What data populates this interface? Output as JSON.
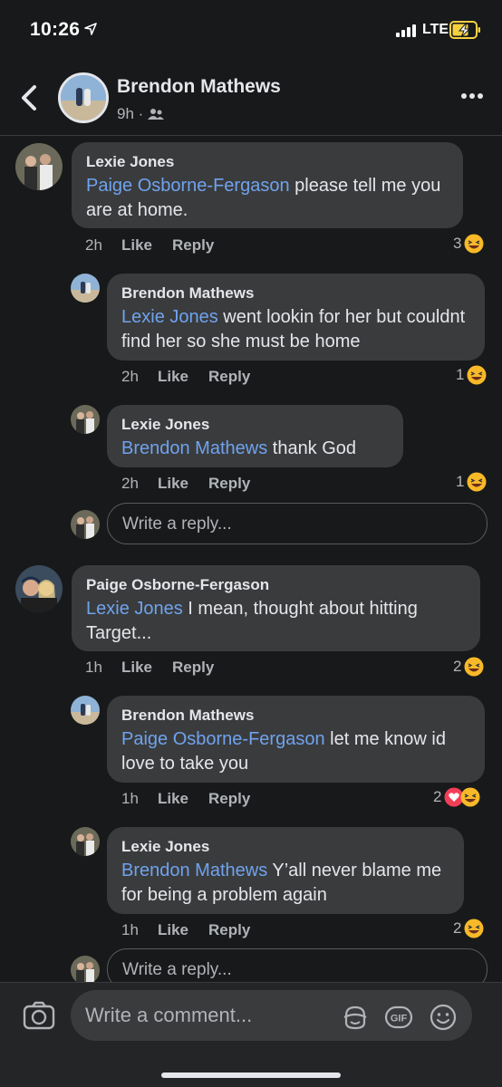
{
  "status_bar": {
    "time": "10:26",
    "network": "LTE"
  },
  "header": {
    "name": "Brendon Mathews",
    "time": "9h ·"
  },
  "threads": [
    {
      "comment": {
        "author": "Lexie Jones",
        "mention": "Paige Osborne-Fergason",
        "text": " please tell me you are at home.",
        "time": "2h",
        "like": "Like",
        "reply": "Reply",
        "count": "3"
      },
      "replies": [
        {
          "author": "Brendon Mathews",
          "mention": "Lexie Jones",
          "text": " went lookin for her but couldnt find her so she must be home",
          "time": "2h",
          "like": "Like",
          "reply": "Reply",
          "count": "1"
        },
        {
          "author": "Lexie Jones",
          "mention": "Brendon Mathews",
          "text": " thank God",
          "time": "2h",
          "like": "Like",
          "reply": "Reply",
          "count": "1"
        }
      ],
      "reply_placeholder": "Write a reply..."
    },
    {
      "comment": {
        "author": "Paige Osborne-Fergason",
        "mention": "Lexie Jones",
        "text": " I mean, thought about hitting Target...",
        "time": "1h",
        "like": "Like",
        "reply": "Reply",
        "count": "2"
      },
      "replies": [
        {
          "author": "Brendon Mathews",
          "mention": "Paige Osborne-Fergason",
          "text": " let me know id love to take you",
          "time": "1h",
          "like": "Like",
          "reply": "Reply",
          "count": "2"
        },
        {
          "author": "Lexie Jones",
          "mention": "Brendon Mathews",
          "text": " Y’all never blame me for being a problem again",
          "time": "1h",
          "like": "Like",
          "reply": "Reply",
          "count": "2"
        }
      ],
      "reply_placeholder": "Write a reply..."
    }
  ],
  "composer": {
    "placeholder": "Write a comment..."
  },
  "colors": {
    "background": "#18191a",
    "bubble": "#3a3b3c",
    "mention": "#6fa3ef",
    "laugh_emoji": "#f7b928",
    "heart": "#f33e58"
  }
}
